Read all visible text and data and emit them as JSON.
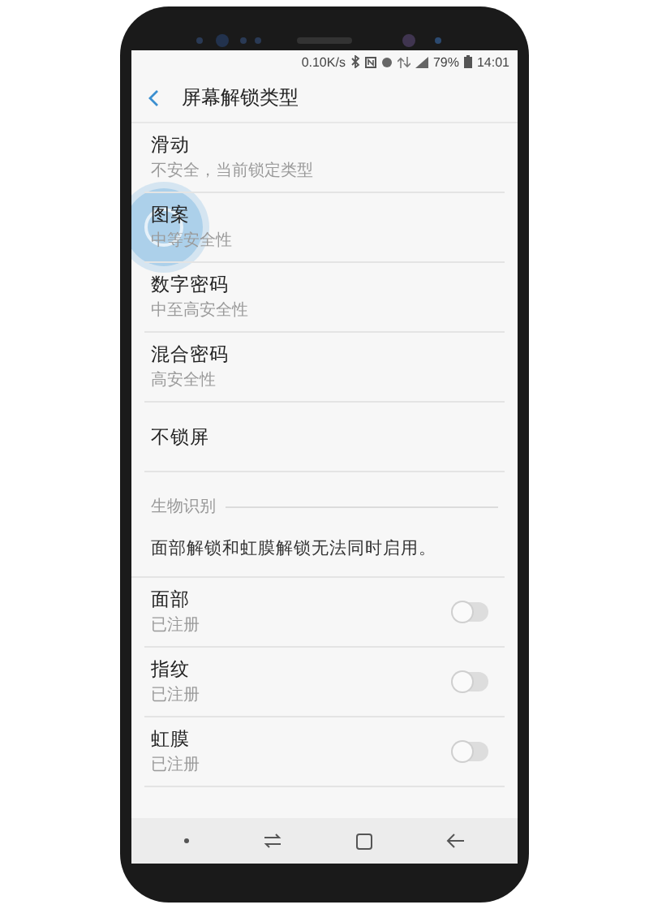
{
  "status_bar": {
    "speed": "0.10K/s",
    "battery": "79%",
    "time": "14:01"
  },
  "header": {
    "title": "屏幕解锁类型"
  },
  "lock_types": [
    {
      "title": "滑动",
      "subtitle": "不安全，当前锁定类型",
      "touched": false
    },
    {
      "title": "图案",
      "subtitle": "中等安全性",
      "touched": true
    },
    {
      "title": "数字密码",
      "subtitle": "中至高安全性",
      "touched": false
    },
    {
      "title": "混合密码",
      "subtitle": "高安全性",
      "touched": false
    },
    {
      "title": "不锁屏",
      "touched": false
    }
  ],
  "section": {
    "title": "生物识别",
    "note": "面部解锁和虹膜解锁无法同时启用。"
  },
  "biometrics": [
    {
      "title": "面部",
      "subtitle": "已注册",
      "on": false
    },
    {
      "title": "指纹",
      "subtitle": "已注册",
      "on": false
    },
    {
      "title": "虹膜",
      "subtitle": "已注册",
      "on": false
    }
  ]
}
